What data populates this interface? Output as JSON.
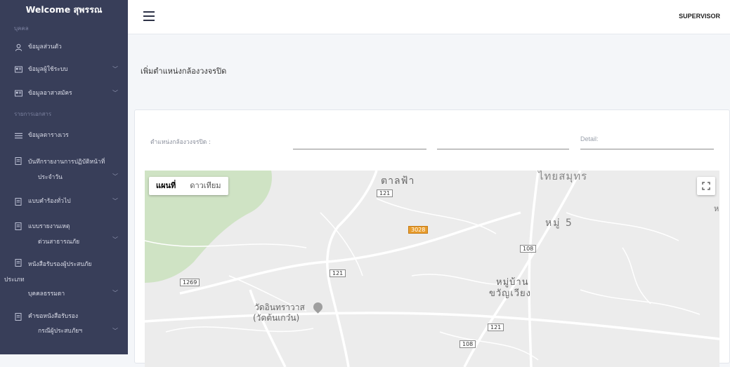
{
  "sidebar": {
    "welcome": "Welcome สุพรรณ",
    "section_person": "บุคคล",
    "section_docs": "รายการเอกสาร",
    "items": [
      {
        "label": "ข้อมูลส่วนตัว",
        "icon": "user-icon"
      },
      {
        "label": "ข้อมูลผู้ใช้ระบบ",
        "icon": "id-card-icon",
        "chevron": "﹀"
      },
      {
        "label": "ข้อมูลอาสาสมัคร",
        "icon": "id-card-icon",
        "chevron": "﹀"
      },
      {
        "label": "ข้อมูลตารางเวร",
        "icon": "list-icon"
      },
      {
        "label": "บันทึกรายงานการปฏิบัติหน้าที่",
        "sub": "ประจำวัน",
        "icon": "document-icon",
        "chevron": "﹀"
      },
      {
        "label": "แบบคำร้องทั่วไป",
        "icon": "document-icon",
        "chevron": "﹀"
      },
      {
        "label": "แบบรายงานเหตุ",
        "sub": "ด่วนสาธารณภัย",
        "icon": "document-icon",
        "chevron": "﹀"
      },
      {
        "label": "หนังสือรับรองผู้ประสบภัย",
        "label2": "ประเภท",
        "sub": "บุคคลธรรมดา",
        "icon": "document-icon",
        "chevron": "﹀"
      },
      {
        "label": "คำขอหนังสือรับรอง",
        "sub": "กรณีผู้ประสบภัยฯ",
        "icon": "document-icon",
        "chevron": "﹀"
      }
    ]
  },
  "topbar": {
    "role": "SUPERVISOR"
  },
  "page": {
    "title": "เพิ่มตำแหน่งกล้องวงจรปิด"
  },
  "form": {
    "position_label": "ตำแหน่งกล้องวงจรปิด :",
    "detail_label": "Detail:"
  },
  "map": {
    "type_map": "แผนที่",
    "type_satellite": "ดาวเทียม",
    "place_labels": [
      "ตาลฟ้า",
      "ไทยสมุทร",
      "หมู่ 5",
      "หมู่บ้าน",
      "ขวัญเวียง",
      "วัดอินทราวาส",
      "(วัดต้นเกว๋น)",
      "ห"
    ],
    "road_labels": [
      "121",
      "3028",
      "108",
      "121",
      "1269",
      "121",
      "108"
    ]
  }
}
